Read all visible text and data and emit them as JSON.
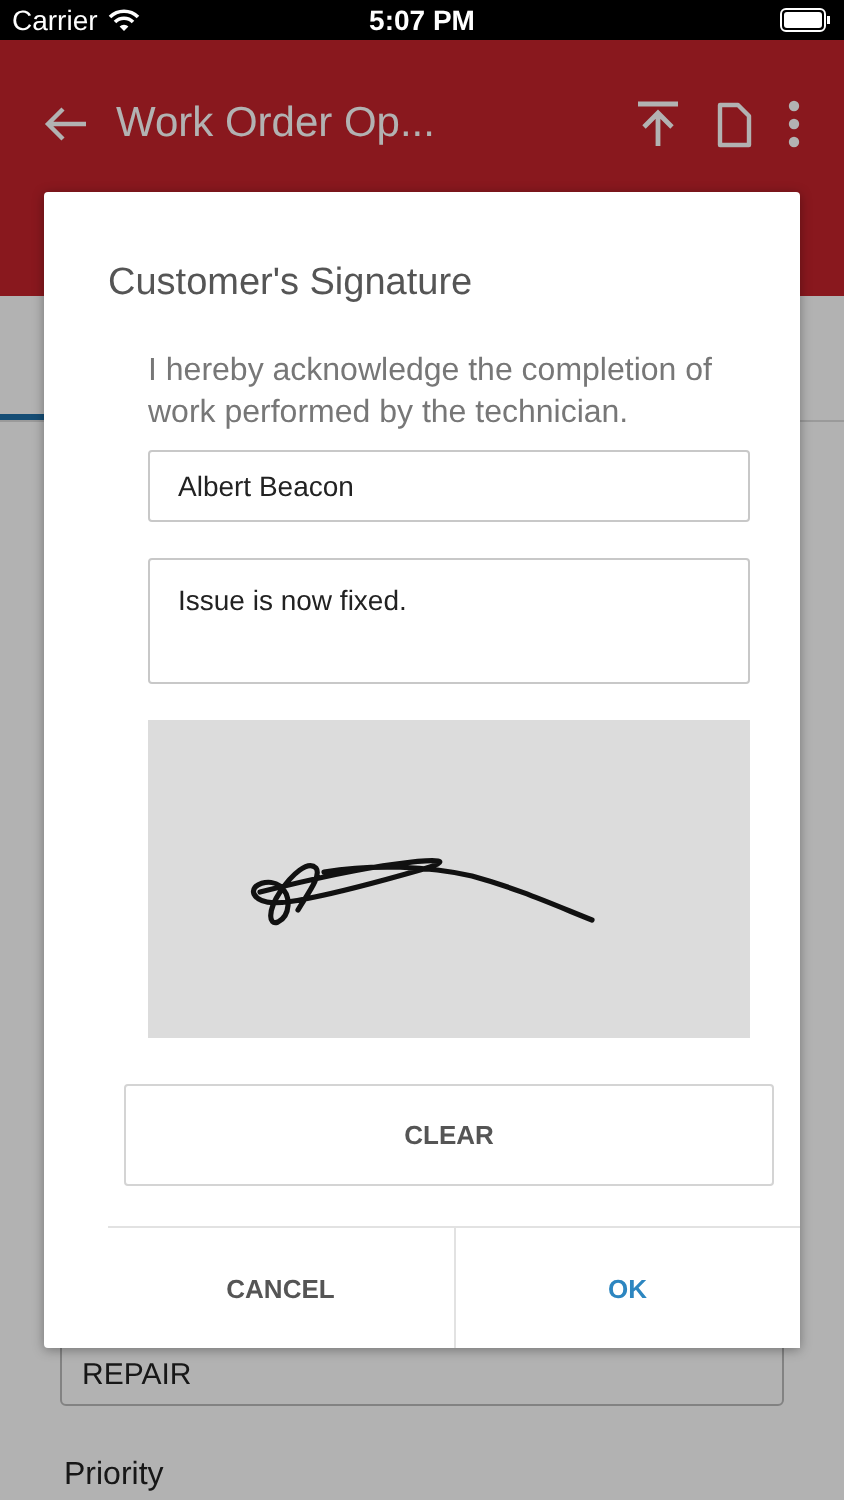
{
  "status_bar": {
    "carrier": "Carrier",
    "time": "5:07 PM"
  },
  "app_bar": {
    "title": "Work Order Op..."
  },
  "background_form": {
    "field_value": "REPAIR",
    "label": "Priority"
  },
  "dialog": {
    "title": "Customer's Signature",
    "message": "I hereby acknowledge the completion of work performed by the technician.",
    "name": {
      "value": "Albert Beacon"
    },
    "notes": {
      "value": "Issue is now fixed."
    },
    "clear_button": "CLEAR",
    "buttons": [
      {
        "label": "CANCEL",
        "kind": "neutral"
      },
      {
        "label": "OK",
        "kind": "primary"
      }
    ]
  }
}
